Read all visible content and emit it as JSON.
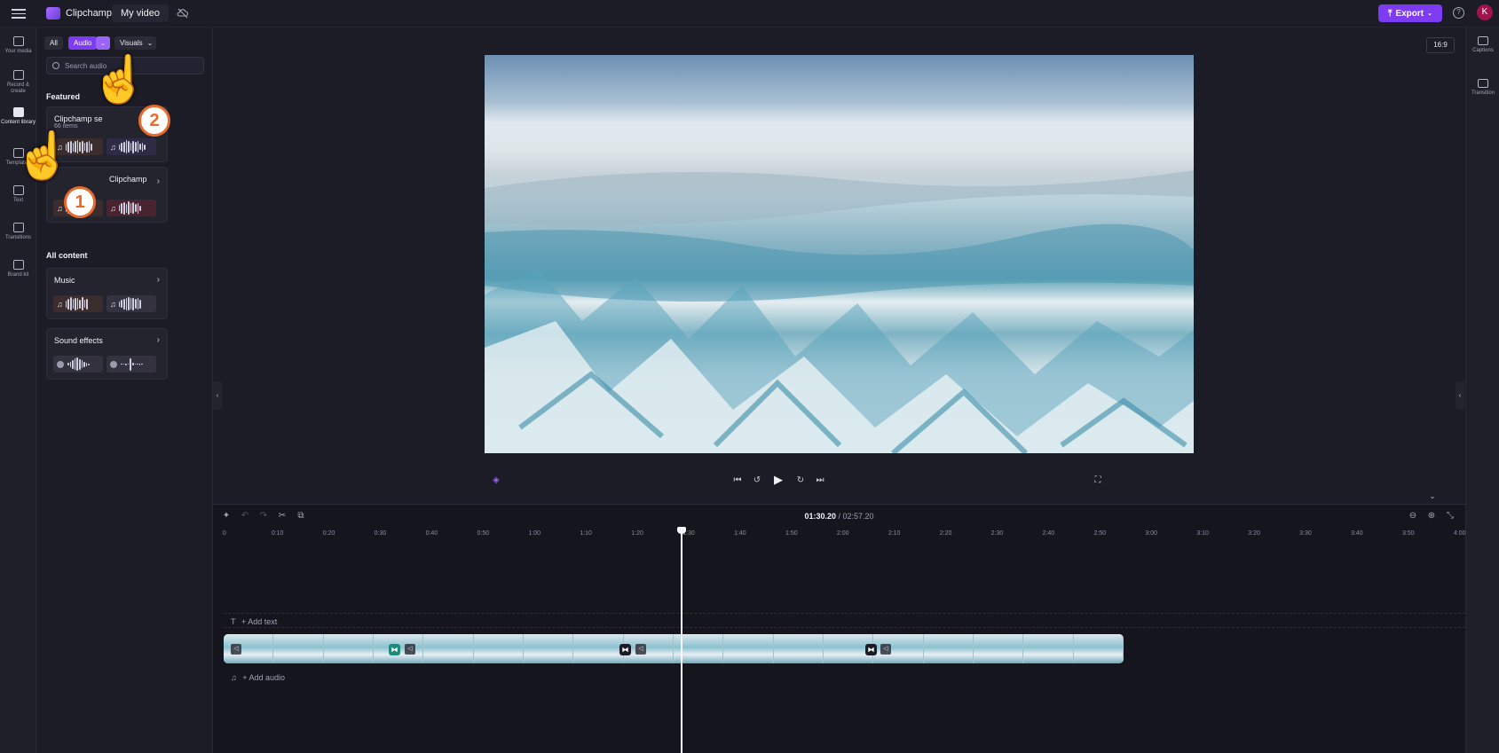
{
  "topbar": {
    "app_name": "Clipchamp",
    "project_name": "My video",
    "export_label": "Export",
    "avatar_initial": "K",
    "accent_color": "#7d3cf2"
  },
  "rail": {
    "items": [
      {
        "label": "Your media",
        "icon": "folder-icon"
      },
      {
        "label": "Record & create",
        "icon": "camera-icon"
      },
      {
        "label": "Content library",
        "icon": "library-icon",
        "active": true
      },
      {
        "label": "Templates",
        "icon": "templates-icon"
      },
      {
        "label": "Text",
        "icon": "text-icon"
      },
      {
        "label": "Transitions",
        "icon": "transitions-icon"
      },
      {
        "label": "Brand kit",
        "icon": "brand-kit-icon"
      }
    ]
  },
  "library": {
    "filters": {
      "all": "All",
      "audio": "Audio",
      "visuals": "Visuals"
    },
    "search_placeholder": "Search audio",
    "featured_title": "Featured",
    "featured_cards": [
      {
        "title": "Clipchamp se",
        "subtitle": "66 items"
      },
      {
        "title": "Clipchamp"
      }
    ],
    "all_content_title": "All content",
    "content_cards": [
      {
        "title": "Music"
      },
      {
        "title": "Sound effects"
      }
    ]
  },
  "preview": {
    "aspect_ratio": "16:9"
  },
  "right_rail": {
    "items": [
      {
        "label": "Captions",
        "icon": "captions-icon"
      },
      {
        "label": "Transition",
        "icon": "transition-icon"
      }
    ]
  },
  "timeline": {
    "current_time": "01:30.20",
    "total_time": "/ 02:57.20",
    "ticks": [
      "0",
      "0:10",
      "0:20",
      "0:30",
      "0:40",
      "0:50",
      "1:00",
      "1:10",
      "1:20",
      "1:30",
      "1:40",
      "1:50",
      "2:00",
      "2:10",
      "2:20",
      "2:30",
      "2:40",
      "2:50",
      "3:00",
      "3:10",
      "3:20",
      "3:30",
      "3:40",
      "3:50",
      "4:00"
    ],
    "add_text_label": "+ Add text",
    "add_audio_label": "+ Add audio"
  },
  "tutorial": {
    "step1": "1",
    "step2": "2"
  }
}
